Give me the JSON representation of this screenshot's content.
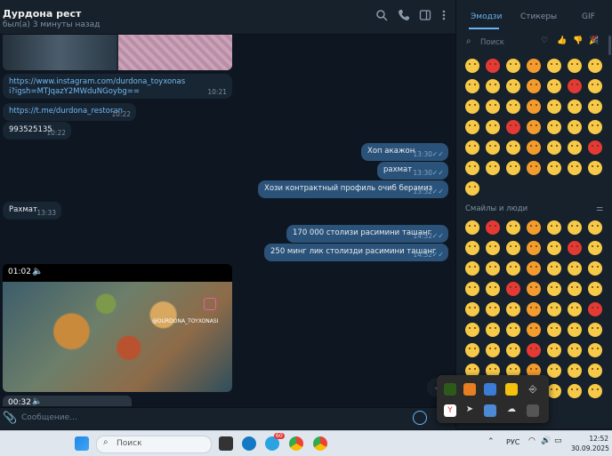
{
  "header": {
    "title": "Дурдона рест",
    "status": "был(а) 3 минуты назад"
  },
  "messages": [
    {
      "dir": "in",
      "text": "https://www.instagram.com/durdona_toyxonasi?igsh=MTJqazY2MWduNGoybg==",
      "time": "10:21"
    },
    {
      "dir": "in",
      "text": "https://t.me/durdona_restoran",
      "time": "10:22"
    },
    {
      "dir": "in",
      "text": "993525135",
      "time": "10:22"
    },
    {
      "dir": "out",
      "text": "Хоп акажон",
      "time": "13:30"
    },
    {
      "dir": "out",
      "text": "рахмат",
      "time": "13:30"
    },
    {
      "dir": "out",
      "text": "Хози контрактный профиль очиб берамиз",
      "time": "13:32"
    },
    {
      "dir": "in",
      "text": "Рахмат",
      "time": "13:33"
    },
    {
      "dir": "out",
      "text": "170 000 столизи расимини ташанг",
      "time": "14:52"
    },
    {
      "dir": "out",
      "text": "250 минг лик столизди расимини ташанг",
      "time": "14:52"
    }
  ],
  "video": {
    "duration": "01:02",
    "watermark": "@DURDONA_TOYXONASI",
    "duration2": "00:32"
  },
  "composer": {
    "placeholder": "Сообщение..."
  },
  "panel": {
    "tabs": [
      "Эмодзи",
      "Стикеры",
      "GIF"
    ],
    "search_placeholder": "Поиск",
    "section_title": "Смайлы и люди"
  },
  "taskbar": {
    "search_placeholder": "Поиск",
    "lang": "РУС",
    "time": "12:52",
    "date": "30.09.2025",
    "badge": "60"
  },
  "colors": {
    "accent": "#6ab3f3",
    "outgoing": "#2b5278",
    "incoming": "#182533"
  }
}
